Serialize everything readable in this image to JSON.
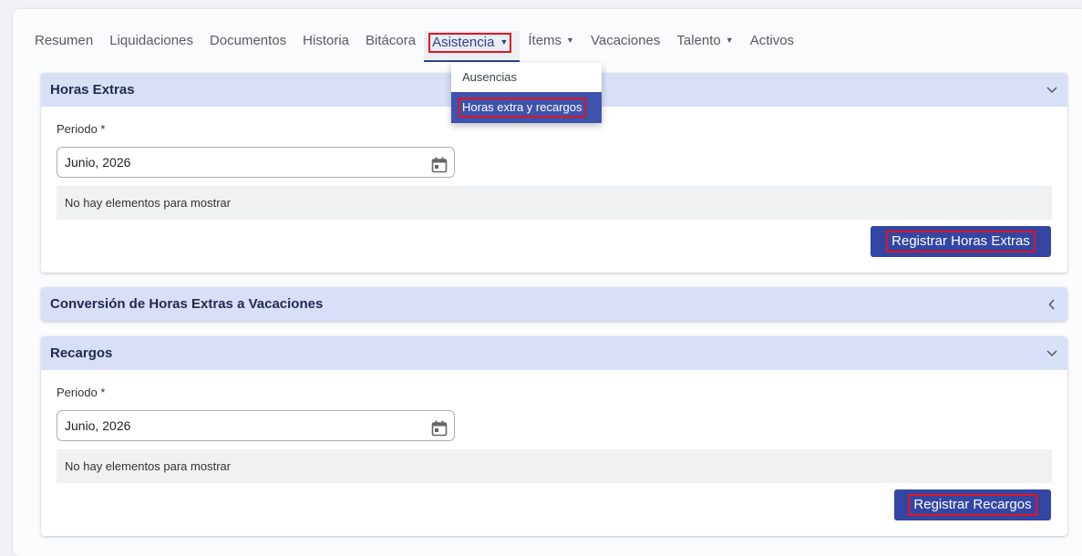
{
  "tabs": [
    {
      "label": "Resumen",
      "dropdown": false
    },
    {
      "label": "Liquidaciones",
      "dropdown": false
    },
    {
      "label": "Documentos",
      "dropdown": false
    },
    {
      "label": "Historia",
      "dropdown": false
    },
    {
      "label": "Bitácora",
      "dropdown": false
    },
    {
      "label": "Asistencia",
      "dropdown": true,
      "active": true
    },
    {
      "label": "Ítems",
      "dropdown": true
    },
    {
      "label": "Vacaciones",
      "dropdown": false
    },
    {
      "label": "Talento",
      "dropdown": true
    },
    {
      "label": "Activos",
      "dropdown": false
    }
  ],
  "dropdown": {
    "items": [
      "Ausencias",
      "Horas extra y recargos"
    ],
    "selected": "Horas extra y recargos"
  },
  "horas_extras": {
    "title": "Horas Extras",
    "period_label": "Periodo *",
    "period_value": "Junio, 2026",
    "empty_text": "No hay elementos para mostrar",
    "button": "Registrar Horas Extras"
  },
  "conversion": {
    "title": "Conversión de Horas Extras a Vacaciones"
  },
  "recargos": {
    "title": "Recargos",
    "period_label": "Periodo *",
    "period_value": "Junio, 2026",
    "empty_text": "No hay elementos para mostrar",
    "button": "Registrar Recargos"
  },
  "colors": {
    "accent": "#3346a3",
    "header_bg": "#d8e0f7",
    "highlight": "#e3141e"
  },
  "icons": {
    "expanded": "chevron-down-icon",
    "collapsed": "chevron-left-icon",
    "calendar": "calendar-icon"
  }
}
